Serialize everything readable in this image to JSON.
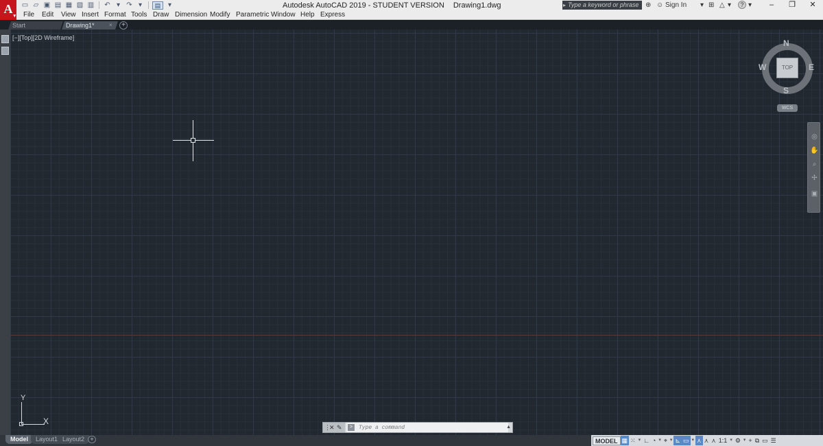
{
  "window": {
    "title": "Autodesk AutoCAD 2019 - STUDENT VERSION",
    "filename": "Drawing1.dwg"
  },
  "app_logo": {
    "letter": "A",
    "caret": "▾"
  },
  "search": {
    "placeholder": "Type a keyword or phrase"
  },
  "account": {
    "sign_in_label": "Sign In",
    "help_label": "?"
  },
  "window_controls": {
    "minimize": "–",
    "restore": "❐",
    "close": "✕"
  },
  "menu": [
    "File",
    "Edit",
    "View",
    "Insert",
    "Format",
    "Tools",
    "Draw",
    "Dimension",
    "Modify",
    "Parametric",
    "Window",
    "Help",
    "Express"
  ],
  "file_tabs": [
    {
      "label": "Start"
    },
    {
      "label": "Drawing1*",
      "active": true,
      "close": "×"
    }
  ],
  "new_tab_label": "+",
  "viewport": {
    "label": "[−][Top][2D Wireframe]"
  },
  "viewcube": {
    "face": "TOP",
    "north": "N",
    "south": "S",
    "east": "E",
    "west": "W",
    "coord_system": "WCS"
  },
  "ucs": {
    "x": "X",
    "y": "Y"
  },
  "command_line": {
    "placeholder": "Type a command"
  },
  "layout_tabs": [
    {
      "label": "Model",
      "active": true
    },
    {
      "label": "Layout1"
    },
    {
      "label": "Layout2"
    }
  ],
  "add_layout_label": "+",
  "status_bar": {
    "model_label": "MODEL",
    "scale_label": "1:1",
    "items": [
      "grid-icon",
      "snap-icon",
      "ortho-icon",
      "polar-icon",
      "isodraft-icon",
      "osnap-icon",
      "lineweight-icon",
      "annotation-icon",
      "scale",
      "gear-icon",
      "plus-icon",
      "clean-screen-icon",
      "menu-icon"
    ]
  },
  "colors": {
    "canvas": "#212830",
    "grid_major": "#2f3947",
    "grid_minor": "#28303b",
    "brand": "#c4161c",
    "accent": "#5a8ac6"
  }
}
